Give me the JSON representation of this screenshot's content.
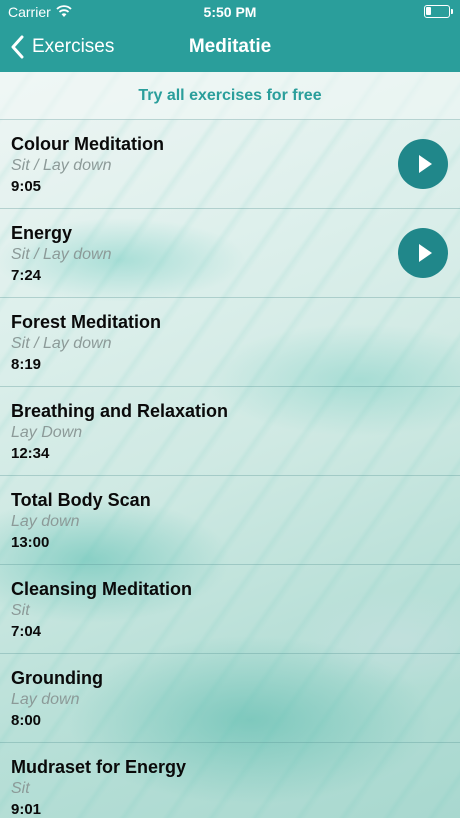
{
  "status_bar": {
    "carrier": "Carrier",
    "time": "5:50 PM",
    "icons": [
      "wifi-icon",
      "battery-icon"
    ]
  },
  "nav": {
    "back_label": "Exercises",
    "title": "Meditatie",
    "back_icon": "chevron-left-icon"
  },
  "promo": {
    "label": "Try all exercises for free"
  },
  "colors": {
    "header": "#2a9e9b",
    "play_button": "#20878a",
    "accent_text": "#2a9e9b",
    "subtitle": "#8c9a98"
  },
  "exercises": [
    {
      "title": "Colour Meditation",
      "position": "Sit / Lay down",
      "duration": "9:05",
      "playable": true
    },
    {
      "title": "Energy",
      "position": "Sit / Lay down",
      "duration": "7:24",
      "playable": true
    },
    {
      "title": "Forest Meditation",
      "position": "Sit / Lay down",
      "duration": "8:19",
      "playable": false
    },
    {
      "title": "Breathing and Relaxation",
      "position": "Lay Down",
      "duration": "12:34",
      "playable": false
    },
    {
      "title": "Total Body Scan",
      "position": "Lay down",
      "duration": "13:00",
      "playable": false
    },
    {
      "title": "Cleansing Meditation",
      "position": "Sit",
      "duration": "7:04",
      "playable": false
    },
    {
      "title": "Grounding",
      "position": "Lay down",
      "duration": "8:00",
      "playable": false
    },
    {
      "title": "Mudraset for Energy",
      "position": "Sit",
      "duration": "9:01",
      "playable": false
    }
  ]
}
